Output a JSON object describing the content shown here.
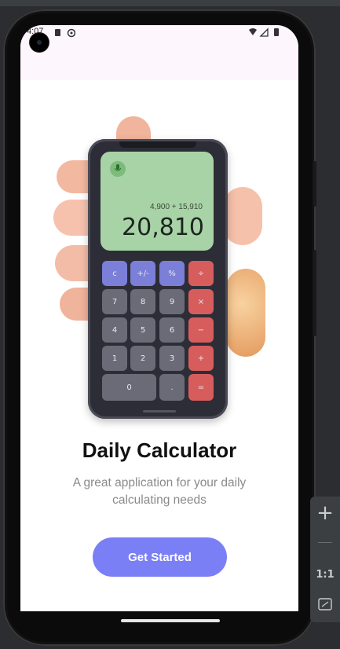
{
  "status_bar": {
    "time": "4:07"
  },
  "calculator": {
    "expression": "4,900 + 15,910",
    "result": "20,810",
    "keys": [
      [
        "c",
        "+/-",
        "%",
        "÷"
      ],
      [
        "7",
        "8",
        "9",
        "×"
      ],
      [
        "4",
        "5",
        "6",
        "−"
      ],
      [
        "1",
        "2",
        "3",
        "+"
      ],
      [
        "0",
        ".",
        "="
      ]
    ]
  },
  "onboarding": {
    "title": "Daily Calculator",
    "subtitle": "A great application for your daily calculating needs",
    "cta_label": "Get Started"
  },
  "emulator_panel": {
    "zoom_label": "1:1"
  },
  "colors": {
    "accent": "#7b7ff5",
    "key_operator": "#d75d5d",
    "key_function": "#7c7fd8",
    "display": "#a8d3a6"
  }
}
